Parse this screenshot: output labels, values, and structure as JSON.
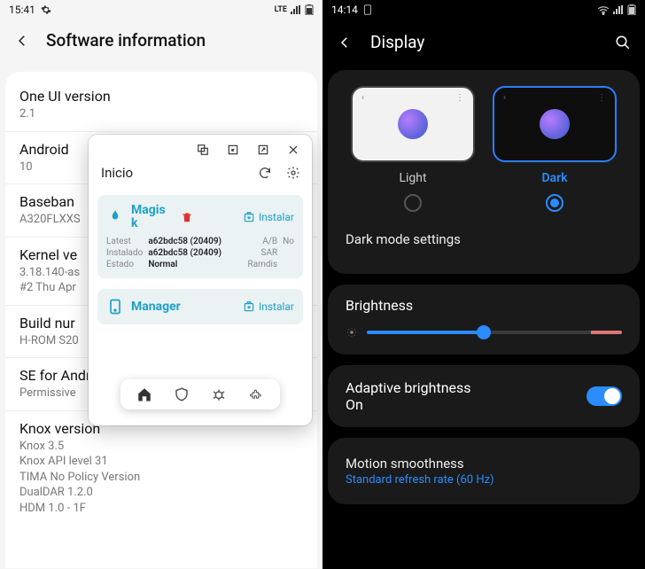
{
  "left": {
    "status": {
      "time": "15:41",
      "net": "LTE"
    },
    "title": "Software information",
    "rows": [
      {
        "label": "One UI version",
        "value": "2.1"
      },
      {
        "label": "Android",
        "value": "10"
      },
      {
        "label": "Baseban",
        "value": "A320FLXXS"
      },
      {
        "label": "Kernel ve",
        "value": "3.18.140-as\n#2 Thu Apr"
      },
      {
        "label": "Build nur",
        "value": "H-ROM S20"
      },
      {
        "label": "SE for Android status",
        "value": "Permissive"
      },
      {
        "label": "Knox version",
        "value": "Knox 3.5\nKnox API level 31\nTIMA No Policy Version\nDualDAR 1.2.0\nHDM 1.0 - 1F"
      }
    ],
    "popup": {
      "title": "Inicio",
      "card1": {
        "name": "Magisk",
        "install": "Instalar",
        "meta": {
          "latest_k": "Latest",
          "latest_v": "a62bdc58 (20409)",
          "inst_k": "Instalado",
          "inst_v": "a62bdc58 (20409)",
          "state_k": "Estado",
          "state_v": "Normal",
          "ab_k": "A/B",
          "ab_v": "No",
          "sar_k": "SAR",
          "ram_k": "Ramdis"
        }
      },
      "card2": {
        "name": "Manager",
        "install": "Instalar"
      }
    }
  },
  "right": {
    "status": {
      "time": "14:14"
    },
    "title": "Display",
    "themes": {
      "light": "Light",
      "dark": "Dark",
      "selected": "dark"
    },
    "dark_mode_row": "Dark mode settings",
    "brightness": {
      "label": "Brightness",
      "percent": 46
    },
    "adaptive": {
      "label": "Adaptive brightness",
      "sub": "On",
      "on": true
    },
    "motion": {
      "label": "Motion smoothness",
      "sub": "Standard refresh rate (60 Hz)"
    }
  }
}
